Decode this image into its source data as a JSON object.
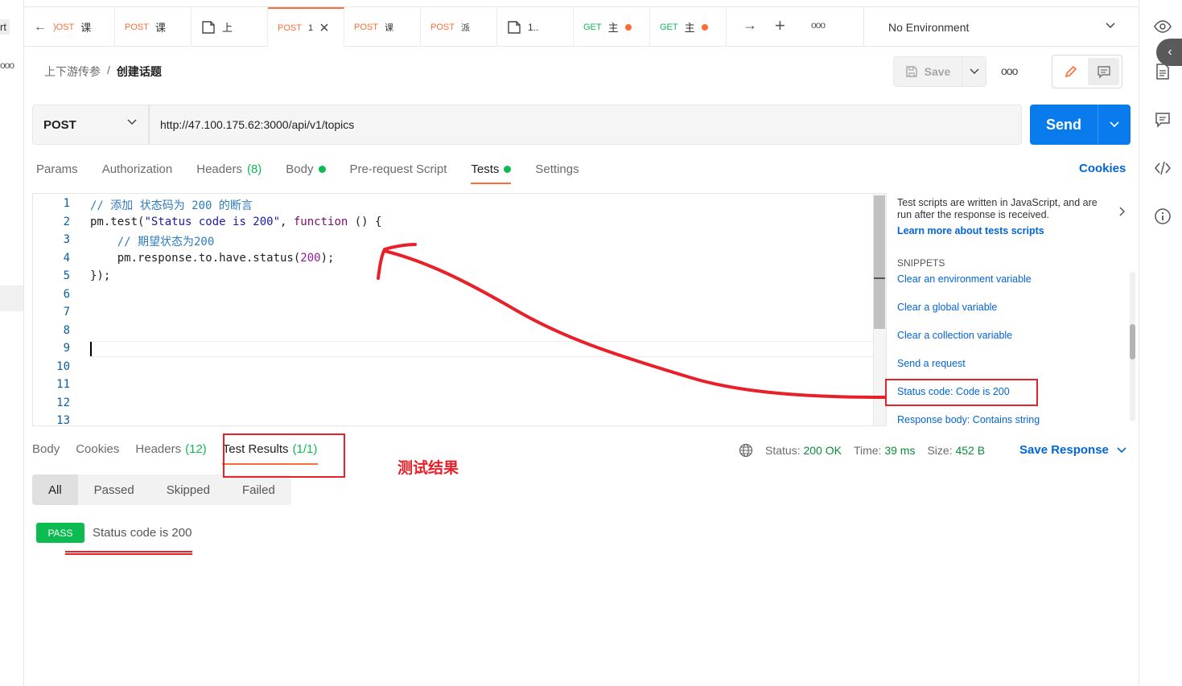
{
  "sidebar_left": {
    "fragment": "rt",
    "more": "ooo"
  },
  "tabs": [
    {
      "method": "POST",
      "title": "课",
      "partial_method": ")OST"
    },
    {
      "method": "POST",
      "title": "课"
    },
    {
      "method": "",
      "title": "上"
    },
    {
      "method": "POST",
      "title": "1"
    },
    {
      "method": "POST",
      "title": "课"
    },
    {
      "method": "POST",
      "title": "派"
    },
    {
      "method": "",
      "title": "1.."
    },
    {
      "method": "GET",
      "title": "主"
    },
    {
      "method": "GET",
      "title": "主"
    }
  ],
  "environment": "No Environment",
  "breadcrumb": {
    "collection": "上下游传参",
    "separator": "/",
    "request": "创建话题"
  },
  "toolbar": {
    "save_label": "Save",
    "more": "ooo"
  },
  "request": {
    "method": "POST",
    "url": "http://47.100.175.62:3000/api/v1/topics",
    "send_label": "Send"
  },
  "request_tabs": {
    "params": "Params",
    "authorization": "Authorization",
    "headers": "Headers",
    "headers_count": "(8)",
    "body": "Body",
    "prerequest": "Pre-request Script",
    "tests": "Tests",
    "settings": "Settings",
    "cookies": "Cookies"
  },
  "editor": {
    "line_numbers": [
      "1",
      "2",
      "3",
      "4",
      "5",
      "6",
      "7",
      "8",
      "9",
      "10",
      "11",
      "12",
      "13"
    ],
    "lines": [
      "// 添加 状态码为 200 的断言",
      "pm.test(\"Status code is 200\", function () {",
      "    // 期望状态为200",
      "    pm.response.to.have.status(200);",
      "});"
    ]
  },
  "snippets": {
    "intro": "Test scripts are written in JavaScript, and are run after the response is received.",
    "learn_more": "Learn more about tests scripts",
    "heading": "SNIPPETS",
    "items": [
      "Clear an environment variable",
      "Clear a global variable",
      "Clear a collection variable",
      "Send a request",
      "Status code: Code is 200",
      "Response body: Contains string"
    ]
  },
  "response": {
    "tabs": {
      "body": "Body",
      "cookies": "Cookies",
      "headers": "Headers",
      "headers_count": "(12)",
      "test_results": "Test Results",
      "test_results_count": "(1/1)"
    },
    "status_label": "Status:",
    "status_value": "200 OK",
    "time_label": "Time:",
    "time_value": "39 ms",
    "size_label": "Size:",
    "size_value": "452 B",
    "save_response": "Save Response",
    "filters": [
      "All",
      "Passed",
      "Skipped",
      "Failed"
    ],
    "result_badge": "PASS",
    "result_text": "Status code is 200"
  },
  "annotation": {
    "label": "测试结果",
    "color": "#e8202a"
  },
  "colors": {
    "accent": "#ff6c37",
    "send": "#097bed",
    "link": "#0265d2",
    "pass": "#0cbb52"
  }
}
